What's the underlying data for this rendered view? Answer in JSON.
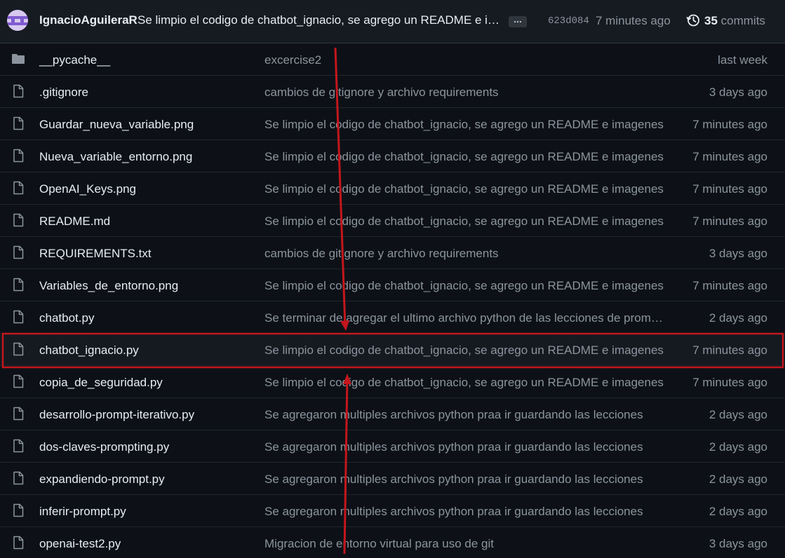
{
  "header": {
    "author": "IgnacioAguileraR",
    "commit_message": "Se limpio el codigo de chatbot_ignacio, se agrego un README e imagenes",
    "ellipsis": "…",
    "sha": "623d084",
    "time": "7 minutes ago",
    "commits_count": "35",
    "commits_label": "commits"
  },
  "files": [
    {
      "type": "folder",
      "name": "__pycache__",
      "message": "excercise2",
      "time": "last week"
    },
    {
      "type": "file",
      "name": ".gitignore",
      "message": "cambios de gitignore y archivo requirements",
      "time": "3 days ago"
    },
    {
      "type": "file",
      "name": "Guardar_nueva_variable.png",
      "message": "Se limpio el codigo de chatbot_ignacio, se agrego un README e imagenes",
      "time": "7 minutes ago"
    },
    {
      "type": "file",
      "name": "Nueva_variable_entorno.png",
      "message": "Se limpio el codigo de chatbot_ignacio, se agrego un README e imagenes",
      "time": "7 minutes ago"
    },
    {
      "type": "file",
      "name": "OpenAI_Keys.png",
      "message": "Se limpio el codigo de chatbot_ignacio, se agrego un README e imagenes",
      "time": "7 minutes ago"
    },
    {
      "type": "file",
      "name": "README.md",
      "message": "Se limpio el codigo de chatbot_ignacio, se agrego un README e imagenes",
      "time": "7 minutes ago"
    },
    {
      "type": "file",
      "name": "REQUIREMENTS.txt",
      "message": "cambios de gitignore y archivo requirements",
      "time": "3 days ago"
    },
    {
      "type": "file",
      "name": "Variables_de_entorno.png",
      "message": "Se limpio el codigo de chatbot_ignacio, se agrego un README e imagenes",
      "time": "7 minutes ago"
    },
    {
      "type": "file",
      "name": "chatbot.py",
      "message": "Se terminar de agregar el ultimo archivo python de las lecciones de prompting",
      "time": "2 days ago"
    },
    {
      "type": "file",
      "name": "chatbot_ignacio.py",
      "message": "Se limpio el codigo de chatbot_ignacio, se agrego un README e imagenes",
      "time": "7 minutes ago",
      "highlighted": true
    },
    {
      "type": "file",
      "name": "copia_de_seguridad.py",
      "message": "Se limpio el codigo de chatbot_ignacio, se agrego un README e imagenes",
      "time": "7 minutes ago"
    },
    {
      "type": "file",
      "name": "desarrollo-prompt-iterativo.py",
      "message": "Se agregaron multiples archivos python praa ir guardando las lecciones",
      "time": "2 days ago"
    },
    {
      "type": "file",
      "name": "dos-claves-prompting.py",
      "message": "Se agregaron multiples archivos python praa ir guardando las lecciones",
      "time": "2 days ago"
    },
    {
      "type": "file",
      "name": "expandiendo-prompt.py",
      "message": "Se agregaron multiples archivos python praa ir guardando las lecciones",
      "time": "2 days ago"
    },
    {
      "type": "file",
      "name": "inferir-prompt.py",
      "message": "Se agregaron multiples archivos python praa ir guardando las lecciones",
      "time": "2 days ago"
    },
    {
      "type": "file",
      "name": "openai-test2.py",
      "message": "Migracion de entorno virtual para uso de git",
      "time": "3 days ago"
    }
  ],
  "colors": {
    "annotation": "#c4161c",
    "text": "#e6edf3",
    "muted": "#8b949e"
  },
  "icons": {
    "folder": "folder-icon",
    "file": "file-icon",
    "history": "history-icon"
  }
}
